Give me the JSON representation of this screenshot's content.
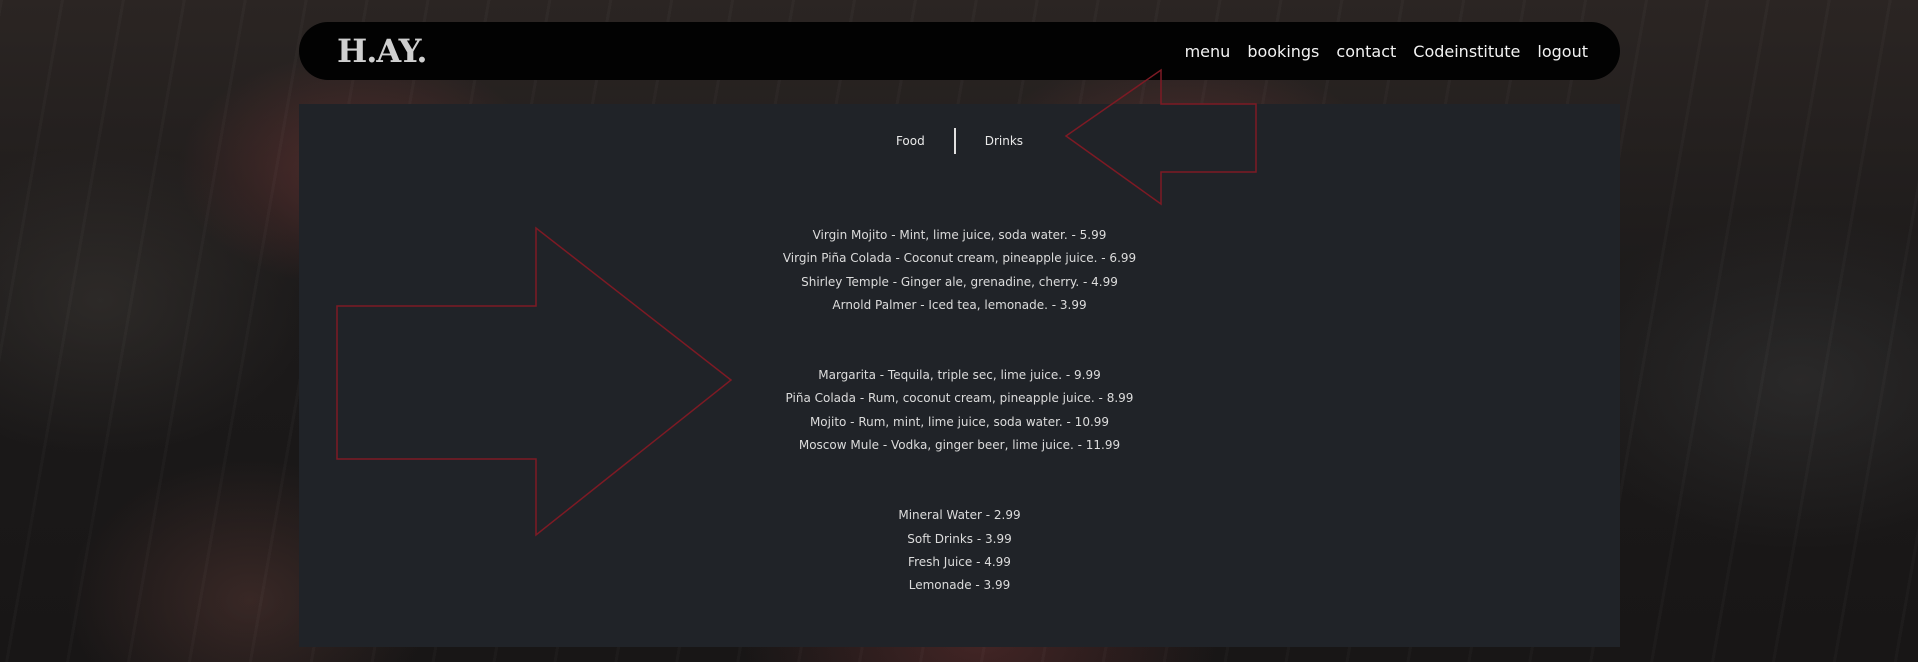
{
  "navbar": {
    "brand": "H.AY.",
    "links": [
      "menu",
      "bookings",
      "contact",
      "Codeinstitute",
      "logout"
    ]
  },
  "tabs": {
    "food": "Food",
    "drinks": "Drinks"
  },
  "menu": {
    "groups": [
      {
        "items": [
          "Virgin Mojito - Mint, lime juice, soda water. - 5.99",
          "Virgin Piña Colada - Coconut cream, pineapple juice. - 6.99",
          "Shirley Temple - Ginger ale, grenadine, cherry. - 4.99",
          "Arnold Palmer - Iced tea, lemonade. - 3.99"
        ]
      },
      {
        "items": [
          "Margarita - Tequila, triple sec, lime juice. - 9.99",
          "Piña Colada - Rum, coconut cream, pineapple juice. - 8.99",
          "Mojito - Rum, mint, lime juice, soda water. - 10.99",
          "Moscow Mule - Vodka, ginger beer, lime juice. - 11.99"
        ]
      },
      {
        "items": [
          "Mineral Water - 2.99",
          "Soft Drinks - 3.99",
          "Fresh Juice - 4.99",
          "Lemonade - 3.99"
        ]
      }
    ]
  },
  "colors": {
    "navbar_bg": "#020202",
    "panel_bg": "#202328",
    "arrow_outline": "#7d1a24"
  },
  "icons": [
    "arrow-outline-left-icon",
    "arrow-outline-right-icon"
  ]
}
